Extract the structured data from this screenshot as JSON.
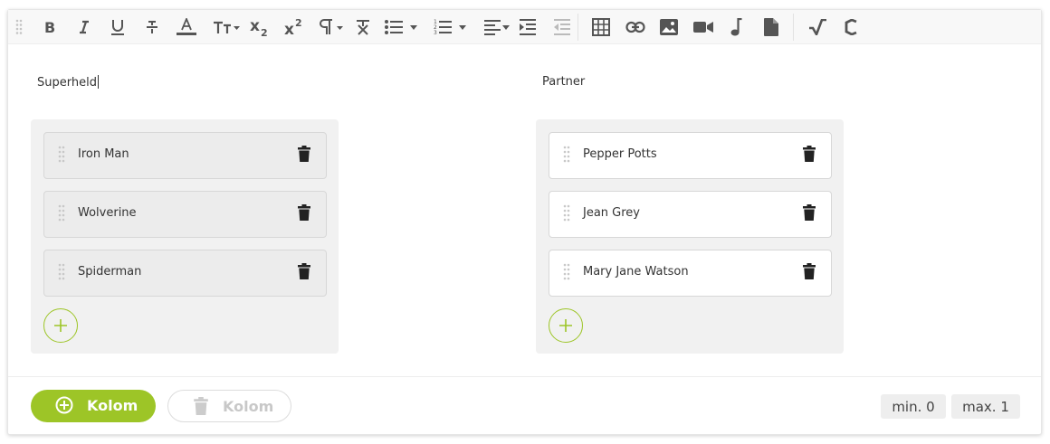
{
  "toolbar": {
    "buttons": [
      {
        "name": "bold",
        "icon": "bold-icon"
      },
      {
        "name": "italic",
        "icon": "italic-icon"
      },
      {
        "name": "underline",
        "icon": "underline-icon"
      },
      {
        "name": "strikethrough",
        "icon": "strikethrough-icon"
      },
      {
        "name": "font-color",
        "icon": "font-color-icon"
      },
      {
        "name": "font-size",
        "icon": "font-size-icon"
      },
      {
        "name": "subscript",
        "icon": "subscript-icon"
      },
      {
        "name": "superscript",
        "icon": "superscript-icon"
      },
      {
        "name": "paragraph-format",
        "icon": "paragraph-icon"
      },
      {
        "name": "clear-formatting",
        "icon": "clear-format-icon"
      },
      {
        "name": "unordered-list",
        "icon": "bullet-list-icon"
      },
      {
        "name": "ordered-list",
        "icon": "numbered-list-icon"
      },
      {
        "name": "align",
        "icon": "align-left-icon"
      },
      {
        "name": "indent",
        "icon": "indent-icon"
      },
      {
        "name": "outdent",
        "icon": "outdent-icon"
      },
      {
        "name": "table",
        "icon": "table-icon"
      },
      {
        "name": "link",
        "icon": "link-icon"
      },
      {
        "name": "image",
        "icon": "image-icon"
      },
      {
        "name": "video",
        "icon": "video-icon"
      },
      {
        "name": "audio",
        "icon": "music-icon"
      },
      {
        "name": "file",
        "icon": "file-icon"
      },
      {
        "name": "math",
        "icon": "sqrt-icon"
      },
      {
        "name": "chemistry",
        "icon": "chemistry-icon"
      }
    ]
  },
  "columns": [
    {
      "label": "Superheld",
      "items": [
        "Iron Man",
        "Wolverine",
        "Spiderman"
      ]
    },
    {
      "label": "Partner",
      "items": [
        "Pepper Potts",
        "Jean Grey",
        "Mary Jane Watson"
      ]
    }
  ],
  "footer": {
    "add_column_label": "Kolom",
    "delete_column_label": "Kolom",
    "min_label": "min. 0",
    "max_label": "max. 1"
  },
  "colors": {
    "accent": "#9dc527",
    "toolbar_icon": "#555555"
  }
}
